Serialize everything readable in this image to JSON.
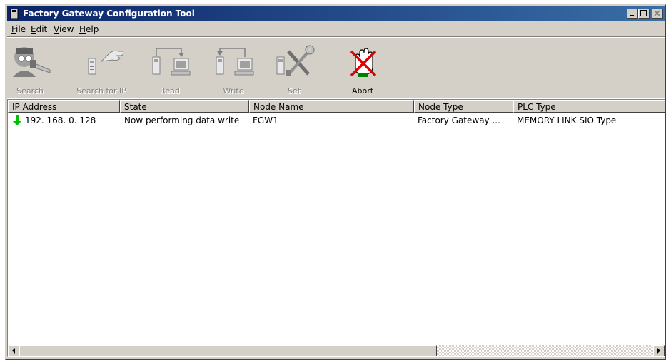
{
  "window": {
    "title": "Factory Gateway Configuration Tool"
  },
  "menu": [
    {
      "accel": "F",
      "rest": "ile"
    },
    {
      "accel": "E",
      "rest": "dit"
    },
    {
      "accel": "V",
      "rest": "iew"
    },
    {
      "accel": "H",
      "rest": "elp"
    }
  ],
  "toolbar": {
    "search": {
      "label": "Search",
      "icon": "search-icon",
      "enabled": false
    },
    "search_ip": {
      "label": "Search for IP",
      "icon": "pointing-hand-icon",
      "enabled": false
    },
    "read": {
      "label": "Read",
      "icon": "read-device-icon",
      "enabled": false
    },
    "write": {
      "label": "Write",
      "icon": "write-device-icon",
      "enabled": false
    },
    "set": {
      "label": "Set",
      "icon": "tools-icon",
      "enabled": false
    },
    "abort": {
      "label": "Abort",
      "icon": "abort-hand-icon",
      "enabled": true
    }
  },
  "table": {
    "columns": [
      "IP Address",
      "State",
      "Node Name",
      "Node Type",
      "PLC Type"
    ],
    "rows": [
      {
        "ip": "192. 168. 0. 128",
        "state": "Now performing data write",
        "node_name": "FGW1",
        "node_type": "Factory Gateway ...",
        "plc_type": "MEMORY LINK SIO Type",
        "status_icon": "green-down-arrow-icon"
      }
    ]
  },
  "colors": {
    "title_start": "#0a246a",
    "title_end": "#3a6ea5",
    "face": "#d4d0c8",
    "arrow": "#00c000",
    "abort_x": "#e00000"
  }
}
